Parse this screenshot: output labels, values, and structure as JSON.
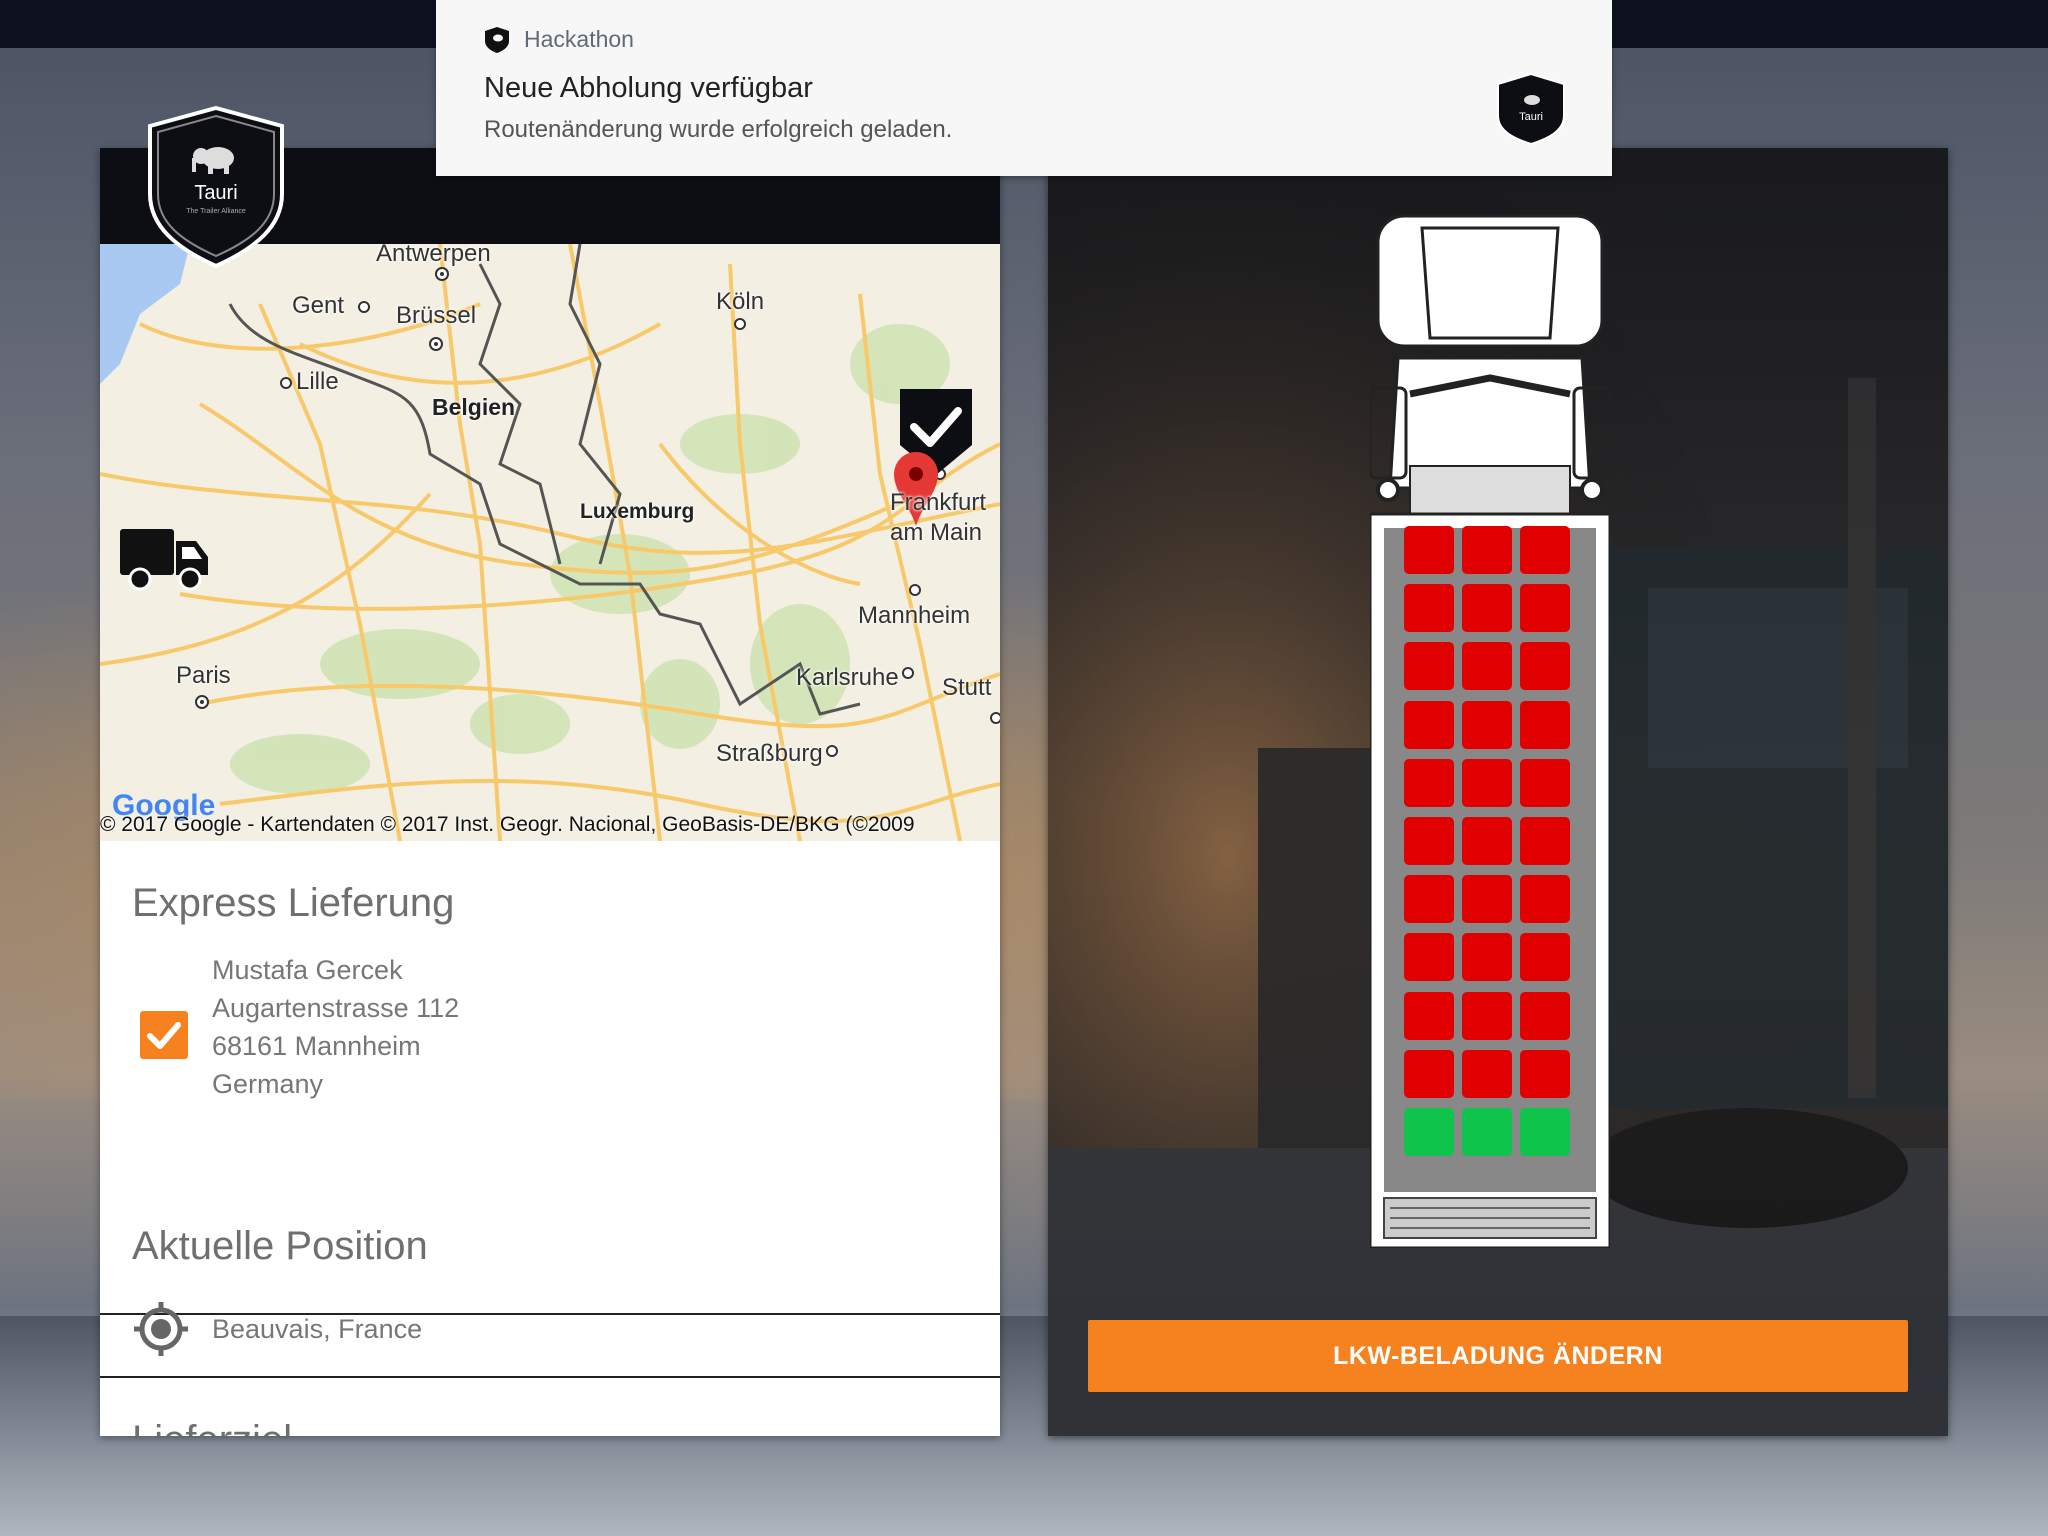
{
  "notification": {
    "app_name": "Hackathon",
    "title": "Neue Abholung verfügbar",
    "text": "Routenänderung wurde erfolgreich geladen.",
    "app_icon": "shield-icon"
  },
  "logo": {
    "name": "Tauri",
    "tagline": "The Trailer Alliance"
  },
  "map": {
    "cities": [
      "Antwerpen",
      "Gent",
      "Brüssel",
      "Lille",
      "Belgien",
      "Köln",
      "Frankfurt am Main",
      "Luxemburg",
      "Mannheim",
      "Paris",
      "Karlsruhe",
      "Stutt",
      "Straßburg"
    ],
    "google_logo": "Google",
    "copyright": "© 2017 Google - Kartendaten © 2017 Inst. Geogr. Nacional, GeoBasis-DE/BKG (©2009"
  },
  "delivery": {
    "title": "Express Lieferung",
    "checked": true,
    "address": [
      "Mustafa Gercek",
      "Augartenstrasse 112",
      "68161 Mannheim",
      "Germany"
    ]
  },
  "position": {
    "title": "Aktuelle Position",
    "value": "Beauvais, France"
  },
  "next_section": {
    "title": "Lieferziel"
  },
  "truck": {
    "rows_full": 10,
    "rows_free": 1,
    "columns": 3,
    "full_color": "#e00000",
    "free_color": "#0fc44a"
  },
  "actions": {
    "change_load_label": "LKW-BELADUNG ÄNDERN"
  },
  "colors": {
    "accent": "#f5821f",
    "header_dark": "#0d0e14"
  }
}
